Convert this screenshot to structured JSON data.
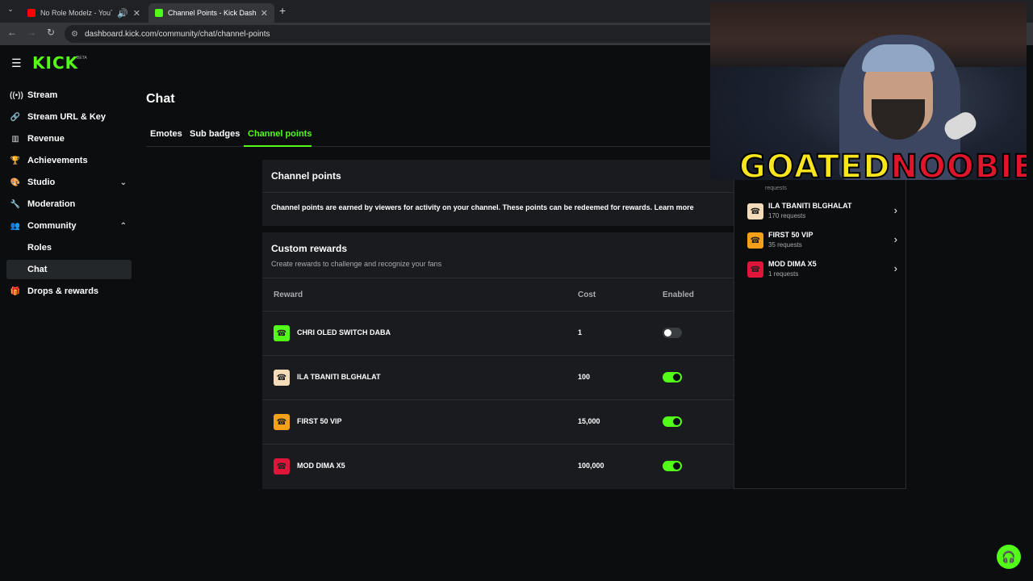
{
  "browser": {
    "tabs": [
      {
        "title": "No Role Modelz - YouTube",
        "favicon_color": "#ff0000"
      },
      {
        "title": "Channel Points - Kick Dashboard",
        "favicon_color": "#53fc18"
      }
    ],
    "url": "dashboard.kick.com/community/chat/channel-points"
  },
  "brand": {
    "logo": "KICK",
    "beta": "BETA",
    "accent": "#53fc18"
  },
  "sidebar": {
    "items": [
      {
        "label": "Stream",
        "icon": "broadcast-icon"
      },
      {
        "label": "Stream URL & Key",
        "icon": "link-icon"
      },
      {
        "label": "Revenue",
        "icon": "chart-icon"
      },
      {
        "label": "Achievements",
        "icon": "trophy-icon"
      },
      {
        "label": "Studio",
        "icon": "palette-icon"
      },
      {
        "label": "Moderation",
        "icon": "wrench-icon"
      },
      {
        "label": "Community",
        "icon": "people-icon"
      },
      {
        "label": "Roles"
      },
      {
        "label": "Chat"
      },
      {
        "label": "Drops & rewards",
        "icon": "gift-icon"
      }
    ]
  },
  "page": {
    "title": "Chat",
    "tabs": [
      "Emotes",
      "Sub badges",
      "Channel points"
    ],
    "active_tab": "Channel points"
  },
  "channel_points_card": {
    "title": "Channel points",
    "description": "Channel points are earned by viewers for activity on your channel. These points can be redeemed for rewards. Learn more"
  },
  "custom_rewards": {
    "title": "Custom rewards",
    "subtitle": "Create rewards to challenge and recognize your fans",
    "columns": [
      "Reward",
      "Cost",
      "Enabled"
    ],
    "rows": [
      {
        "name": "CHRI OLED SWITCH DABA",
        "cost": "1",
        "enabled": false,
        "color": "#53fc18"
      },
      {
        "name": "ILA TBANITI BLGHALAT",
        "cost": "100",
        "enabled": true,
        "color": "#f5dcb9"
      },
      {
        "name": "FIRST 50 VIP",
        "cost": "15,000",
        "enabled": true,
        "color": "#f6a01a"
      },
      {
        "name": "MOD DIMA X5",
        "cost": "100,000",
        "enabled": true,
        "color": "#e0153a"
      }
    ]
  },
  "requests_panel": {
    "clipped_text": "requests",
    "items": [
      {
        "name": "ILA TBANITI BLGHALAT",
        "requests": "170 requests",
        "color": "#f5dcb9"
      },
      {
        "name": "FIRST 50 VIP",
        "requests": "35 requests",
        "color": "#f6a01a"
      },
      {
        "name": "MOD DIMA X5",
        "requests": "1 requests",
        "color": "#e0153a"
      }
    ]
  },
  "webcam_overlay": {
    "name_part1": "GOATED",
    "name_part2": "NOOBIE"
  }
}
